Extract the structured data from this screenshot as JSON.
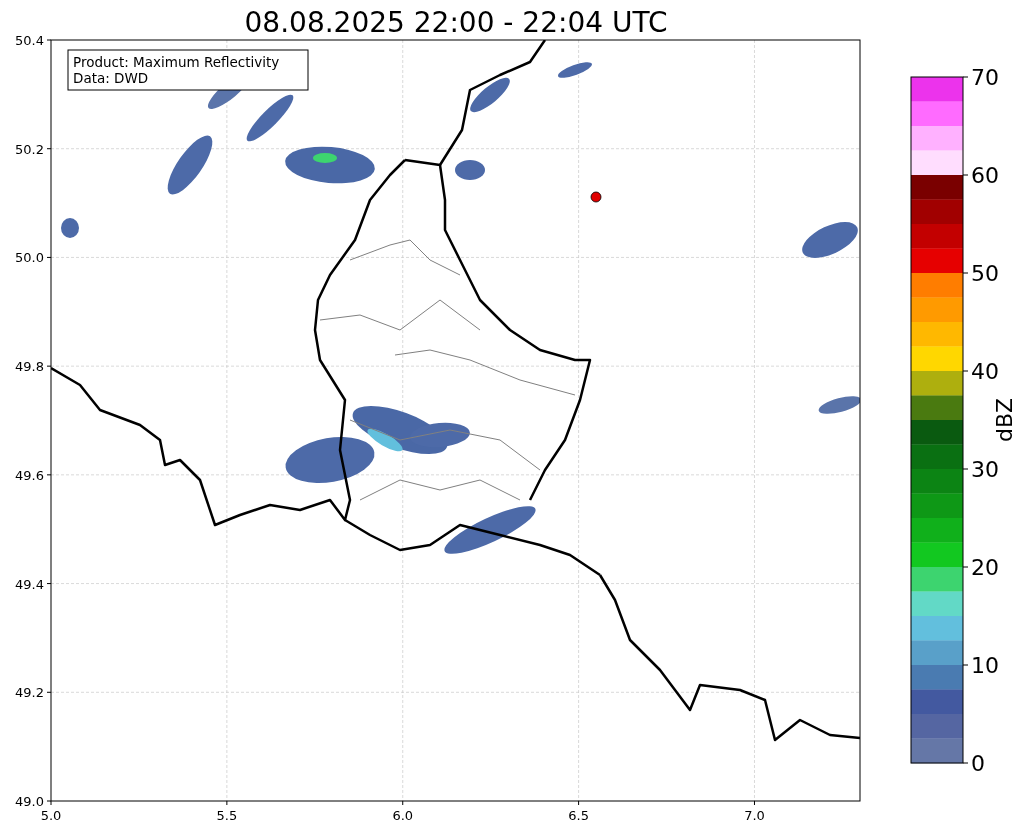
{
  "title": "08.08.2025 22:00 - 22:04 UTC",
  "info_box": {
    "lines": [
      "Product: Maximum Reflectivity",
      "Data: DWD"
    ]
  },
  "map": {
    "x_ticks": [
      "5.0",
      "5.5",
      "6.0",
      "6.5",
      "7.0"
    ],
    "y_ticks": [
      "50.4",
      "50.2",
      "50.0",
      "49.8",
      "49.6",
      "49.4",
      "49.2",
      "49.0"
    ]
  },
  "colorbar": {
    "label": "dBZ",
    "ticks": [
      "70",
      "60",
      "50",
      "40",
      "30",
      "20",
      "10",
      "0"
    ],
    "bands": [
      {
        "color": "#ec33ec"
      },
      {
        "color": "#ff6bff"
      },
      {
        "color": "#ffb1ff"
      },
      {
        "color": "#ffddfe"
      },
      {
        "color": "#7a0000"
      },
      {
        "color": "#a10000"
      },
      {
        "color": "#c30000"
      },
      {
        "color": "#e60000"
      },
      {
        "color": "#ff7d00"
      },
      {
        "color": "#ff9a00"
      },
      {
        "color": "#ffb800"
      },
      {
        "color": "#ffd700"
      },
      {
        "color": "#aeaf0e"
      },
      {
        "color": "#4a7a10"
      },
      {
        "color": "#0a5a10"
      },
      {
        "color": "#0a7012"
      },
      {
        "color": "#0c8414"
      },
      {
        "color": "#0e9816"
      },
      {
        "color": "#10b01b"
      },
      {
        "color": "#12c820"
      },
      {
        "color": "#3dd46f"
      },
      {
        "color": "#62d9c6"
      },
      {
        "color": "#62bfdd"
      },
      {
        "color": "#59a0c9"
      },
      {
        "color": "#4a7bb1"
      },
      {
        "color": "#4359a0"
      },
      {
        "color": "#5566a2"
      },
      {
        "color": "#6577a7"
      }
    ]
  }
}
